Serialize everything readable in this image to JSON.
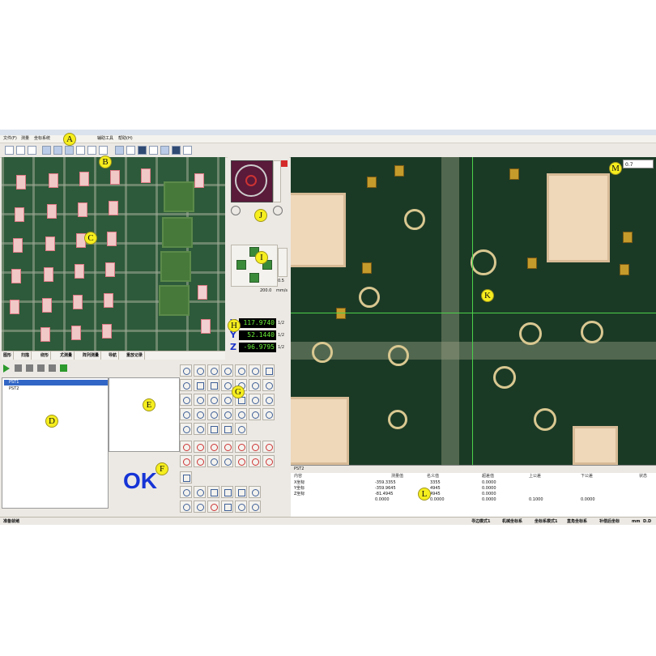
{
  "menu": {
    "items": [
      "文件(F)",
      "测量",
      "坐标系统"
    ],
    "items_right": [
      "辅助工具",
      "帮助(H)"
    ]
  },
  "callouts": [
    "A",
    "B",
    "C",
    "D",
    "E",
    "F",
    "G",
    "H",
    "I",
    "J",
    "K",
    "L",
    "M"
  ],
  "bottom_tabs": [
    "图形",
    "扫描",
    "绕形",
    "尤测量",
    "阵列测量",
    "导航",
    "重放记录"
  ],
  "program_list": [
    {
      "label": "PST1",
      "selected": true
    },
    {
      "label": "PST2",
      "selected": false
    }
  ],
  "ok_text": "OK",
  "dro": {
    "x": {
      "axis": "X",
      "value": "117.9740",
      "unit": "1/2"
    },
    "y": {
      "axis": "Y",
      "value": "52.1440",
      "unit": "1/2"
    },
    "z": {
      "axis": "Z",
      "value": "-96.9795",
      "unit": "1/2"
    },
    "value_color": "#6cf23a"
  },
  "nav": {
    "speed_label": "200.0",
    "speed_unit": "mm/s",
    "step_label": "0.5"
  },
  "camera": {
    "zoom_select": "0.7"
  },
  "result_table": {
    "name": "PST2",
    "headers": [
      "内容",
      "测量值",
      "名义值",
      "超差值",
      "上公差",
      "下公差",
      "状态"
    ],
    "rows": [
      {
        "name": "X坐标",
        "measured": "-359.3355",
        "nominal": "3355",
        "deviation": "0.0000",
        "upper": "",
        "lower": ""
      },
      {
        "name": "Y坐标",
        "measured": "-359.9645",
        "nominal": "4945",
        "deviation": "0.0000",
        "upper": "",
        "lower": ""
      },
      {
        "name": "Z坐标",
        "measured": "-81.4945",
        "nominal": "4945",
        "deviation": "0.0000",
        "upper": "",
        "lower": ""
      },
      {
        "name": "",
        "measured": "0.0000",
        "nominal": "0.0000",
        "deviation": "0.0000",
        "upper": "0.1000",
        "lower": "0.0000"
      }
    ]
  },
  "status": {
    "left": "准备就绪",
    "right_1": "寻边模式1",
    "right_2": "机械坐标系",
    "right_3": "坐标系模式1",
    "right_4": "直角坐标系",
    "right_5": "补偿后坐标",
    "right_6": "mm",
    "right_7": "D.D"
  }
}
